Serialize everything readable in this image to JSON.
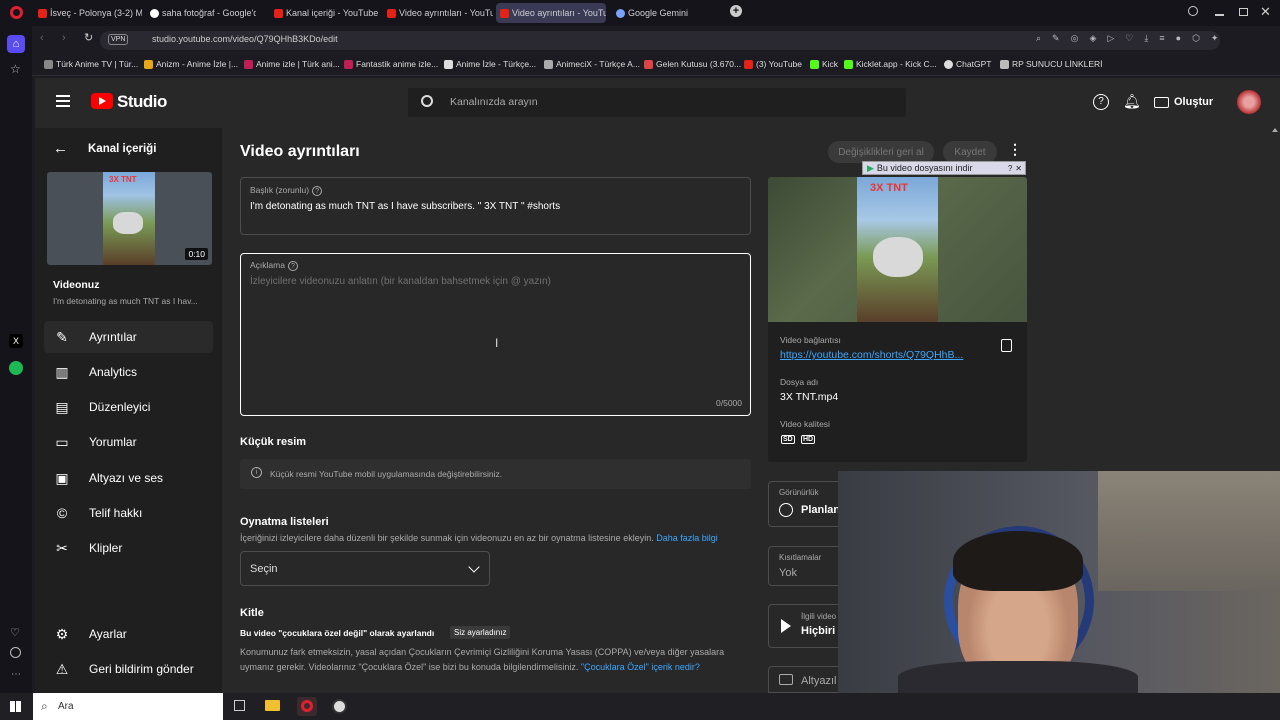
{
  "browser": {
    "tabs": [
      {
        "label": "İsveç - Polonya (3-2) Maç",
        "color": "#e62117"
      },
      {
        "label": "saha fotoğraf - Google'da",
        "color": "#ffffff"
      },
      {
        "label": "Kanal içeriği - YouTube St",
        "color": "#e62117"
      },
      {
        "label": "Video ayrıntıları - YouTub",
        "color": "#e62117"
      },
      {
        "label": "Video ayrıntıları - YouTub",
        "color": "#e62117"
      },
      {
        "label": "Google Gemini",
        "color": "#7aa2ff"
      }
    ],
    "new_tab": "+",
    "vpn": "VPN",
    "url": "studio.youtube.com/video/Q79QHhB3KDo/edit",
    "bookmarks": [
      "Türk Anime TV | Tür...",
      "Anizm - Anime İzle |...",
      "Anime izle | Türk ani...",
      "Fantastik anime izle...",
      "Anime İzle - Türkçe...",
      "AnimeciX - Türkçe A...",
      "Gelen Kutusu (3.670...",
      "(3) YouTube",
      "Kick",
      "Kicklet.app - Kick C...",
      "ChatGPT",
      "RP SUNUCU LİNKLERİ"
    ]
  },
  "studio": {
    "logo": "Studio",
    "search_placeholder": "Kanalınızda arayın",
    "create_label": "Oluştur",
    "back_label": "Kanal içeriği",
    "thumb_text": "3X TNT",
    "duration": "0:10",
    "your_video": "Videonuz",
    "your_video_title": "I'm detonating as much TNT as I hav...",
    "nav": [
      {
        "label": "Ayrıntılar",
        "icon": "pencil-icon"
      },
      {
        "label": "Analytics",
        "icon": "analytics-icon"
      },
      {
        "label": "Düzenleyici",
        "icon": "editor-icon"
      },
      {
        "label": "Yorumlar",
        "icon": "comments-icon"
      },
      {
        "label": "Altyazı ve ses",
        "icon": "subtitles-icon"
      },
      {
        "label": "Telif hakkı",
        "icon": "copyright-icon"
      },
      {
        "label": "Klipler",
        "icon": "scissors-icon"
      }
    ],
    "settings": "Ayarlar",
    "feedback": "Geri bildirim gönder"
  },
  "details": {
    "heading": "Video ayrıntıları",
    "undo_label": "Değişiklikleri geri al",
    "save_label": "Kaydet",
    "title_label": "Başlık (zorunlu)",
    "title_value": "I'm detonating as much TNT as I have subscribers. \" 3X TNT \" #shorts",
    "desc_label": "Açıklama",
    "desc_placeholder": "İzleyicilere videonuzu anlatın (bir kanaldan bahsetmek için @ yazın)",
    "desc_counter": "0/5000",
    "thumb_heading": "Küçük resim",
    "thumb_info": "Küçük resmi YouTube mobil uygulamasında değiştirebilirsiniz.",
    "playlists_heading": "Oynatma listeleri",
    "playlists_desc": "İçeriğinizi izleyicilere daha düzenli bir şekilde sunmak için videonuzu en az bir oynatma listesine ekleyin.",
    "playlists_link": "Daha fazla bilgi",
    "select_label": "Seçin",
    "audience_heading": "Kitle",
    "audience_status": "Bu video \"çocuklara özel değil\" olarak ayarlandı",
    "audience_badge": "Siz ayarladınız",
    "audience_desc_1": "Konumunuz fark etmeksizin, yasal açıdan Çocukların Çevrimiçi Gizliliğini Koruma Yasası (COPPA) ve/veya diğer yasalara",
    "audience_desc_2": "uymanız gerekir. Videolarınız \"Çocuklara Özel\" ise bizi bu konuda bilgilendirmelisiniz.",
    "audience_link": "\"Çocuklara Özel\" içerik nedir?"
  },
  "side": {
    "download_label": "Bu video dosyasını indir",
    "preview_text": "3X TNT",
    "link_label": "Video bağlantısı",
    "link_value": "https://youtube.com/shorts/Q79QHhB...",
    "file_label": "Dosya adı",
    "file_value": "3X TNT.mp4",
    "quality_label": "Video kalitesi",
    "quality_sd": "SD",
    "quality_hd": "HD",
    "visibility_label": "Görünürlük",
    "visibility_value": "Planlan",
    "restrictions_label": "Kısıtlamalar",
    "restrictions_value": "Yok",
    "endscreen_label": "İlgili video",
    "endscreen_value": "Hiçbiri",
    "subtitles_label": "Altyazıl"
  },
  "taskbar": {
    "search": "Ara"
  }
}
